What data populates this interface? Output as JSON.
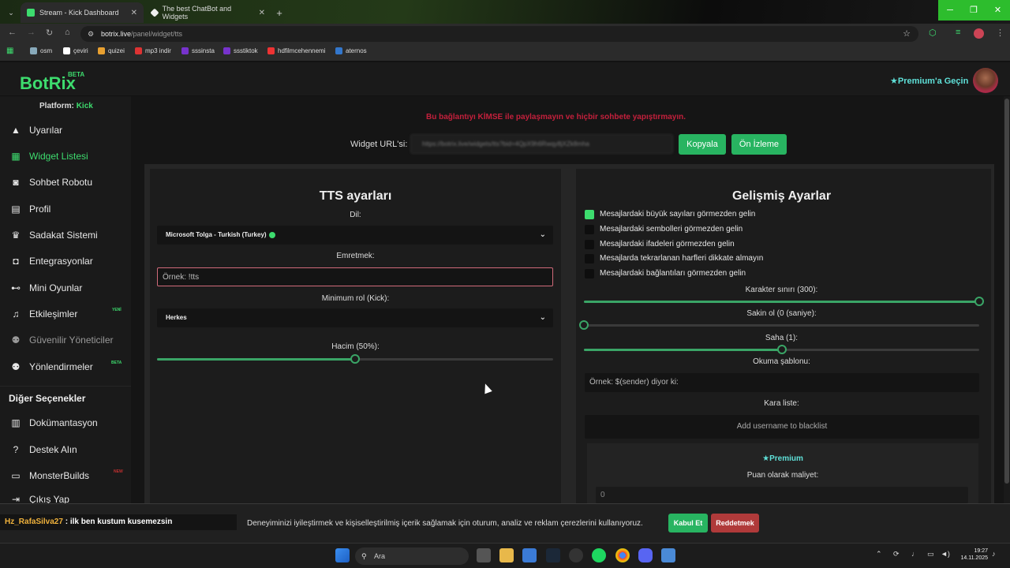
{
  "browser": {
    "tabs": [
      {
        "title": "Stream - Kick Dashboard",
        "active": true
      },
      {
        "title": "The best ChatBot and Widgets",
        "active": false
      }
    ],
    "url_host": "botrix.live",
    "url_path": "/panel/widget/tts",
    "bookmarks": [
      "osm",
      "çeviri",
      "quizei",
      "mp3 indir",
      "sssinsta",
      "ssstiktok",
      "hdfilmcehennemi",
      "aternos"
    ]
  },
  "app": {
    "logo": "BotRix",
    "logo_badge": "BETA",
    "premium_button": "Premium'a Geçin",
    "platform_label": "Platform:",
    "platform_value": "Kick"
  },
  "sidebar": {
    "items": [
      {
        "label": "Uyarılar",
        "icon": "warning-icon"
      },
      {
        "label": "Widget Listesi",
        "icon": "grid-icon"
      },
      {
        "label": "Sohbet Robotu",
        "icon": "robot-icon"
      },
      {
        "label": "Profil",
        "icon": "id-card-icon"
      },
      {
        "label": "Sadakat Sistemi",
        "icon": "trophy-icon"
      },
      {
        "label": "Entegrasyonlar",
        "icon": "plug-icon"
      },
      {
        "label": "Mini Oyunlar",
        "icon": "gamepad-icon"
      },
      {
        "label": "Etkileşimler",
        "icon": "music-icon",
        "badge": "YENİ"
      },
      {
        "label": "Güvenilir Yöneticiler",
        "icon": "users-icon"
      },
      {
        "label": "Yönlendirmeler",
        "icon": "users-icon",
        "badge": "BETA"
      }
    ],
    "other_title": "Diğer Seçenekler",
    "other_items": [
      {
        "label": "Dokümantasyon",
        "icon": "book-icon"
      },
      {
        "label": "Destek Alın",
        "icon": "question-icon"
      },
      {
        "label": "MonsterBuilds",
        "icon": "laptop-icon",
        "badge": "NEW"
      },
      {
        "label": "Çıkış Yap",
        "icon": "logout-icon"
      }
    ]
  },
  "main": {
    "warning": "Bu bağlantıyı KİMSE ile paylaşmayın ve hiçbir sohbete yapıştırmayın.",
    "widget_url_label": "Widget URL'si:",
    "widget_url_value": "https://botrix.live/widgets/tts?bid=4QpX9h6Rwqy8jXZk8mha",
    "copy_button": "Kopyala",
    "preview_button": "Ön İzleme"
  },
  "tts": {
    "title": "TTS ayarları",
    "language_label": "Dil:",
    "language_value": "Microsoft Tolga - Turkish (Turkey)",
    "command_label": "Emretmek:",
    "command_placeholder": "Örnek: !tts",
    "minrole_label": "Minimum rol (Kick):",
    "minrole_value": "Herkes",
    "volume_label": "Hacim (50%):",
    "volume_value": 50
  },
  "advanced": {
    "title": "Gelişmiş Ayarlar",
    "checks": [
      {
        "label": "Mesajlardaki büyük sayıları görmezden gelin",
        "checked": true
      },
      {
        "label": "Mesajlardaki sembolleri görmezden gelin",
        "checked": false
      },
      {
        "label": "Mesajlardaki ifadeleri görmezden gelin",
        "checked": false
      },
      {
        "label": "Mesajlarda tekrarlanan harfleri dikkate almayın",
        "checked": false
      },
      {
        "label": "Mesajlardaki bağlantıları görmezden gelin",
        "checked": false
      }
    ],
    "char_limit_label": "Karakter sınırı (300):",
    "char_limit_fraction": 1.0,
    "cooldown_label": "Sakin ol (0 (saniye):",
    "cooldown_fraction": 0.0,
    "pitch_label": "Saha (1):",
    "pitch_fraction": 0.5,
    "template_label": "Okuma şablonu:",
    "template_placeholder": "Örnek: $(sender) diyor ki:",
    "blacklist_label": "Kara liste:",
    "blacklist_placeholder": "Add username to blacklist",
    "premium_title": "Premium",
    "cost_label": "Puan olarak maliyet:",
    "cost_value": "0"
  },
  "chat": {
    "user": "Hz_RafaSilva27",
    "message": " : ilk ben kustum kusemezsin"
  },
  "cookie": {
    "text": "Deneyiminizi iyileştirmek ve kişiselleştirilmiş içerik sağlamak için oturum, analiz ve reklam çerezlerini kullanıyoruz.",
    "accept": "Kabul Et",
    "reject": "Reddetmek"
  },
  "taskbar": {
    "search": "Ara",
    "time": "19:27",
    "date": "14.11.2025"
  },
  "colors": {
    "accent": "#3ddc6e",
    "button": "#28b461",
    "danger": "#b03a3a",
    "warning": "#c4203c"
  }
}
